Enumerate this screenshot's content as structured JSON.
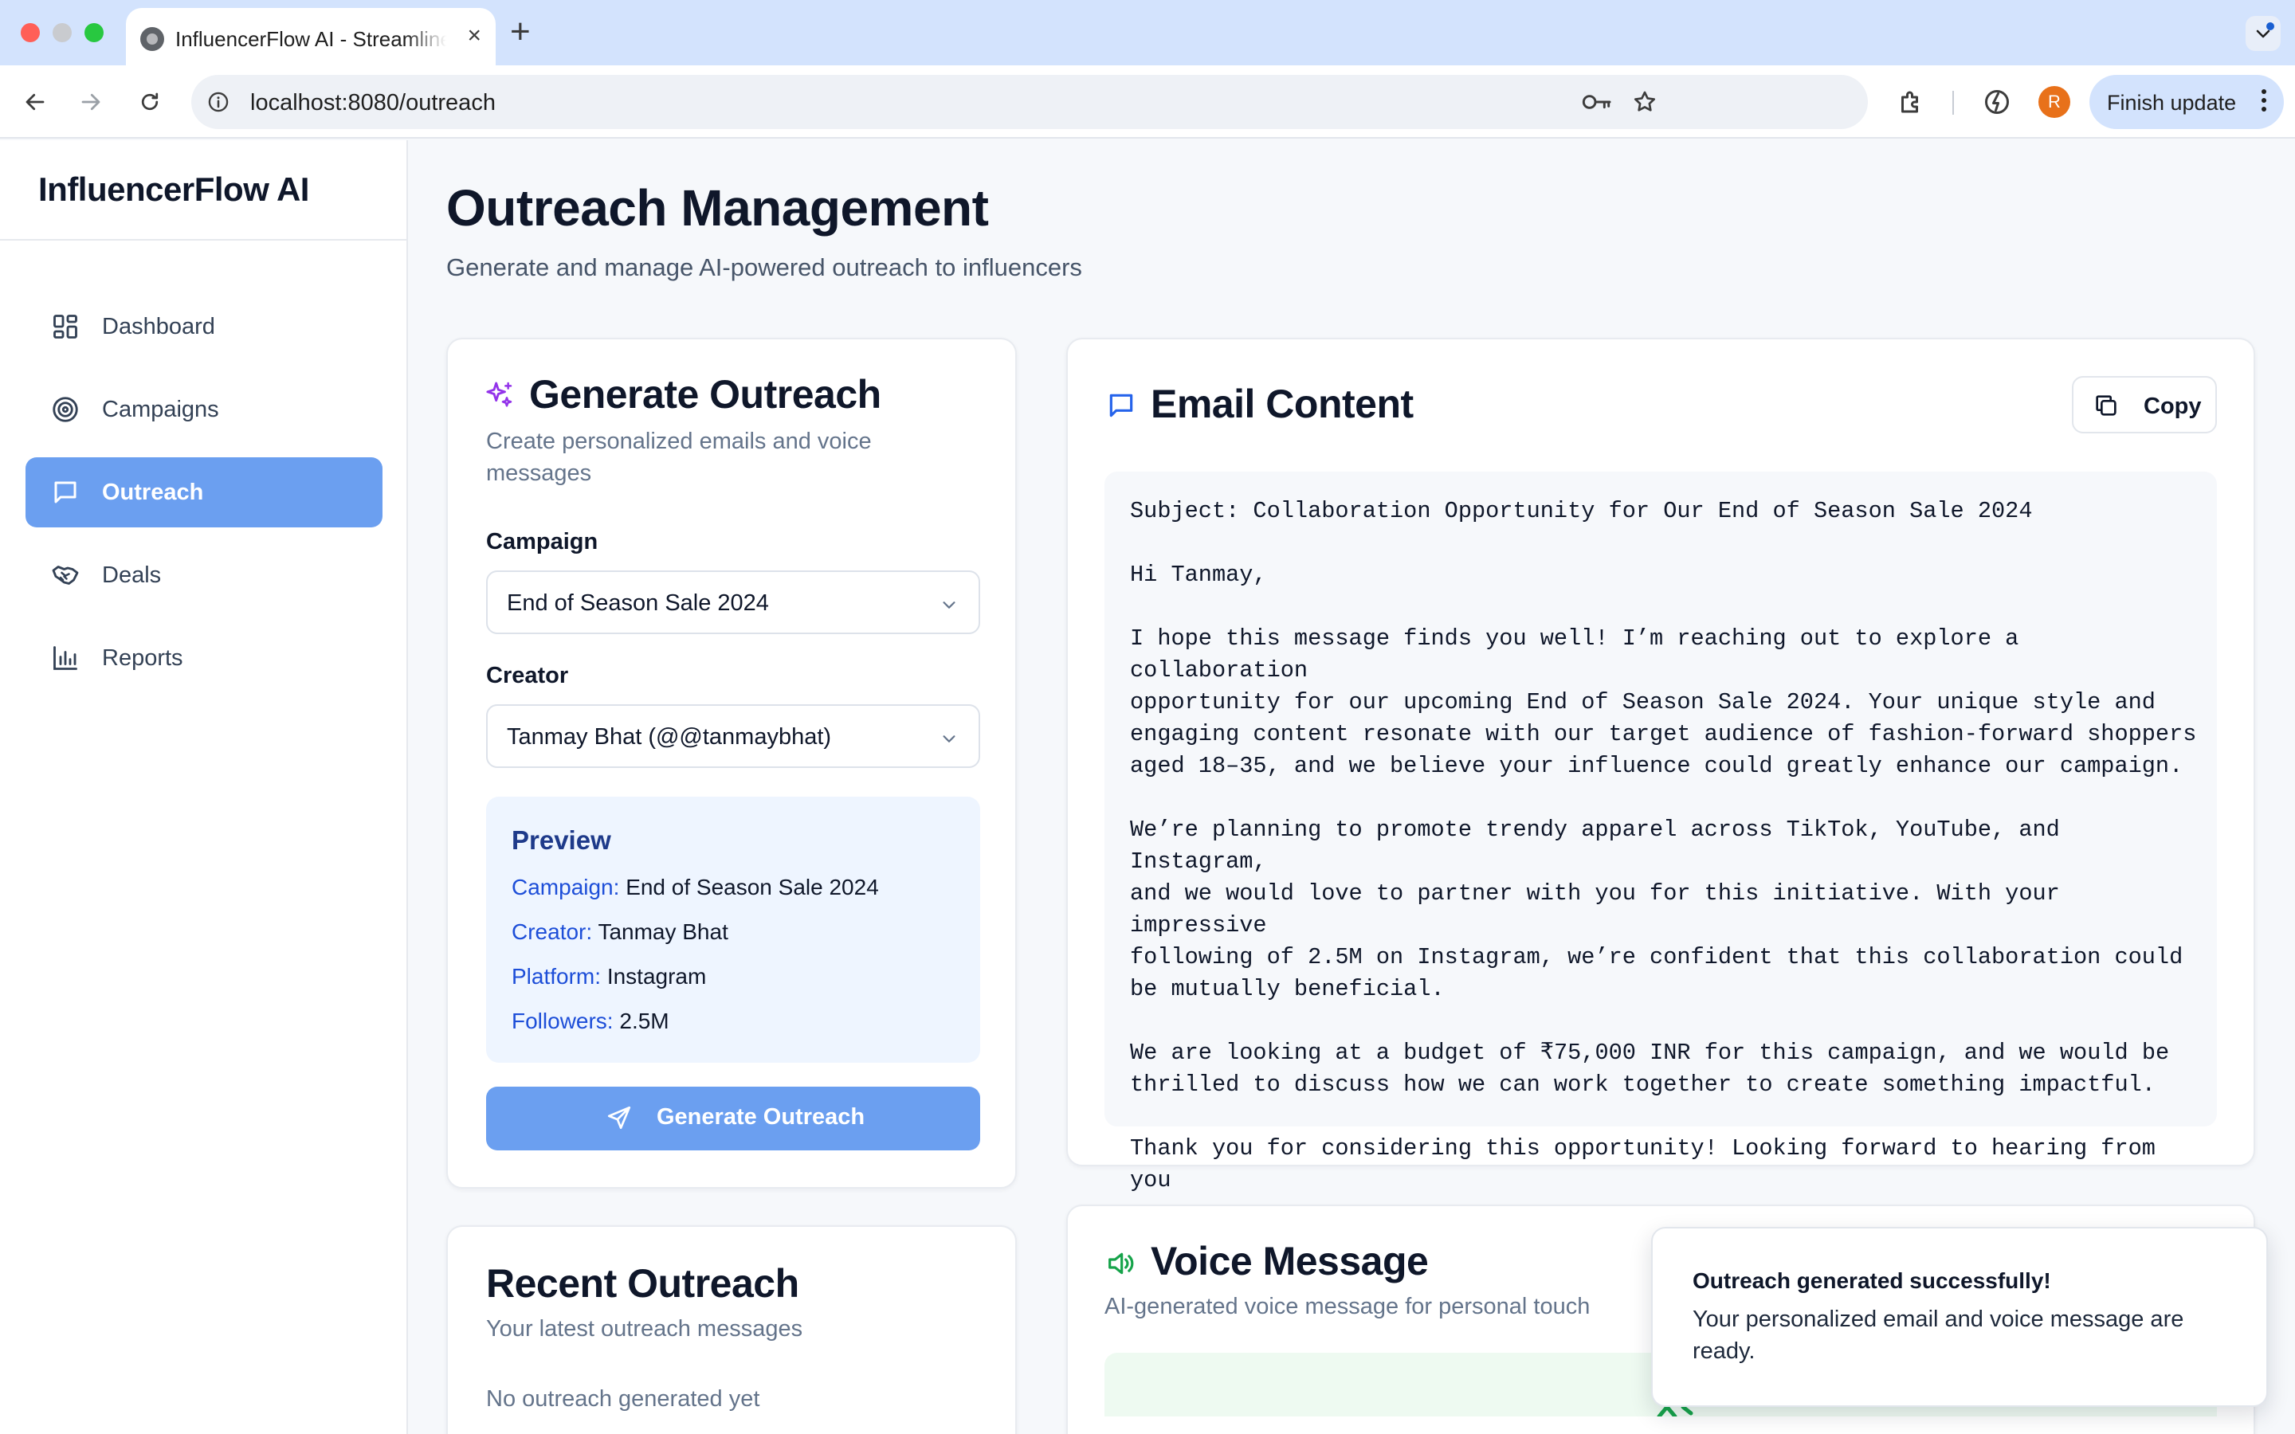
{
  "browser": {
    "tab_title": "InfluencerFlow AI - Streamline Influencer Marketing",
    "url": "localhost:8080/outreach",
    "avatar_letter": "R",
    "finish_update_label": "Finish update"
  },
  "sidebar": {
    "brand": "InfluencerFlow AI",
    "items": [
      {
        "label": "Dashboard",
        "icon": "dashboard-icon",
        "active": false
      },
      {
        "label": "Campaigns",
        "icon": "target-icon",
        "active": false
      },
      {
        "label": "Outreach",
        "icon": "message-icon",
        "active": true
      },
      {
        "label": "Deals",
        "icon": "handshake-icon",
        "active": false
      },
      {
        "label": "Reports",
        "icon": "bar-chart-icon",
        "active": false
      }
    ]
  },
  "page": {
    "title": "Outreach Management",
    "subtitle": "Generate and manage AI-powered outreach to influencers"
  },
  "generate": {
    "title": "Generate Outreach",
    "subtitle": "Create personalized emails and voice messages",
    "campaign_label": "Campaign",
    "campaign_value": "End of Season Sale 2024",
    "creator_label": "Creator",
    "creator_value": "Tanmay Bhat (@@tanmaybhat)",
    "preview": {
      "title": "Preview",
      "rows": [
        {
          "key": "Campaign:",
          "value": "End of Season Sale 2024"
        },
        {
          "key": "Creator:",
          "value": "Tanmay Bhat"
        },
        {
          "key": "Platform:",
          "value": "Instagram"
        },
        {
          "key": "Followers:",
          "value": "2.5M"
        }
      ]
    },
    "button_label": "Generate Outreach"
  },
  "recent": {
    "title": "Recent Outreach",
    "subtitle": "Your latest outreach messages",
    "empty_text": "No outreach generated yet"
  },
  "email": {
    "title": "Email Content",
    "copy_label": "Copy",
    "body": "Subject: Collaboration Opportunity for Our End of Season Sale 2024\n\nHi Tanmay,\n\nI hope this message finds you well! I’m reaching out to explore a collaboration\nopportunity for our upcoming End of Season Sale 2024. Your unique style and\nengaging content resonate with our target audience of fashion-forward shoppers\naged 18–35, and we believe your influence could greatly enhance our campaign.\n\nWe’re planning to promote trendy apparel across TikTok, YouTube, and Instagram,\nand we would love to partner with you for this initiative. With your impressive\nfollowing of 2.5M on Instagram, we’re confident that this collaboration could\nbe mutually beneficial.\n\nWe are looking at a budget of ₹75,000 INR for this campaign, and we would be\nthrilled to discuss how we can work together to create something impactful.\n\nThank you for considering this opportunity! Looking forward to hearing from you\nsoon."
  },
  "voice": {
    "title": "Voice Message",
    "subtitle": "AI-generated voice message for personal touch"
  },
  "toast": {
    "title": "Outreach generated successfully!",
    "body": "Your personalized email and voice message are ready."
  },
  "colors": {
    "accent": "#6b9ff0",
    "preview_bg": "#eef5ff",
    "sparkle": "#9333ea",
    "voice_green": "#16a34a"
  }
}
